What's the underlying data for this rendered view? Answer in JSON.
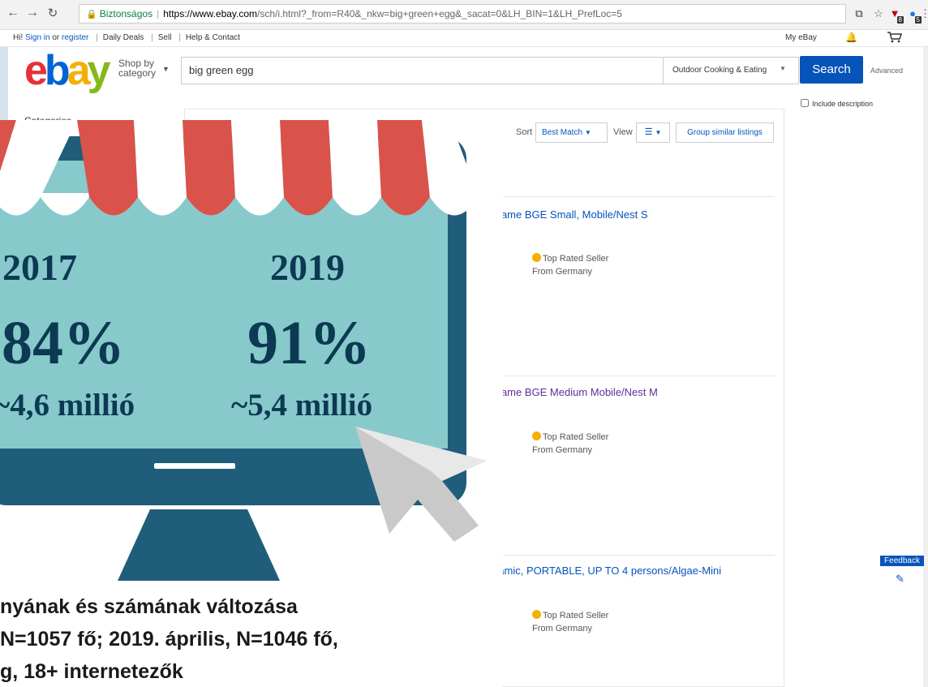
{
  "browser": {
    "secure_label": "Biztonságos",
    "url_host": "https://www.ebay.com",
    "url_path": "/sch/i.html?_from=R40&_nkw=big+green+egg&_sacat=0&LH_BIN=1&LH_PrefLoc=5",
    "ext_badge_1": "8",
    "ext_badge_2": "5"
  },
  "topbar": {
    "greeting": "Hi! ",
    "sign_in": "Sign in",
    "or": " or ",
    "register": "register",
    "daily_deals": "Daily Deals",
    "sell": "Sell",
    "help": "Help & Contact",
    "my_ebay": "My eBay"
  },
  "header": {
    "shop_by_line1": "Shop by",
    "shop_by_line2": "category",
    "search_value": "big green egg",
    "category_selected": "Outdoor Cooking & Eating",
    "search_button": "Search",
    "advanced": "Advanced",
    "include_description": "Include description"
  },
  "sidebar": {
    "categories_label": "Categories"
  },
  "results": {
    "sort_label": "Sort",
    "sort_value": "Best Match",
    "view_label": "View",
    "group_similar": "Group similar listings",
    "items": [
      {
        "title": "frame BGE Small, Mobile/Nest S",
        "badge": "Top Rated Seller",
        "location": "From Germany"
      },
      {
        "title": "frame BGE Medium Mobile/Nest M",
        "badge": "Top Rated Seller",
        "location": "From Germany"
      },
      {
        "title": "ramic, PORTABLE, UP TO 4 persons/Algae-Mini",
        "badge": "Top Rated Seller",
        "location": "From Germany"
      }
    ]
  },
  "feedback": {
    "label": "Feedback"
  },
  "overlay": {
    "year_1": "2017",
    "year_2": "2019",
    "pct_1": "84%",
    "pct_2": "91%",
    "count_1": "~4,6 millió",
    "count_2": "~5,4 millió",
    "caption_1": "nyának és számának változása",
    "caption_2": "N=1057 fő; 2019. április, N=1046 fő,",
    "caption_3": "g, 18+ internetezők"
  },
  "colors": {
    "ebay_blue": "#0654ba",
    "awning_red": "#d9534a",
    "screen_teal": "#88c9cc",
    "monitor_frame": "#1f5d7a"
  }
}
